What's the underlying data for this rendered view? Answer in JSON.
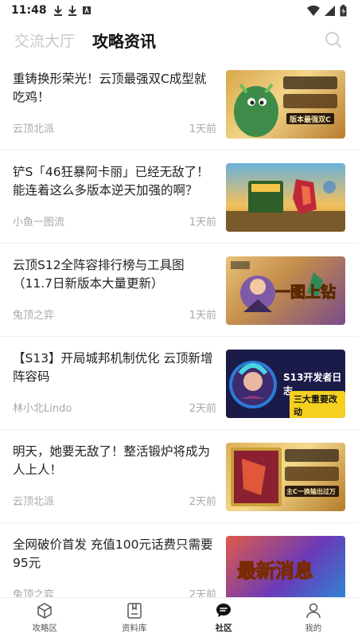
{
  "status": {
    "time": "11:48"
  },
  "header": {
    "tab_inactive": "交流大厅",
    "tab_active": "攻略资讯"
  },
  "articles": [
    {
      "title": "重铸换形荣光！云顶最强双C成型就吃鸡！",
      "author": "云顶北派",
      "time": "1天前",
      "thumb_text": "版本最强双C"
    },
    {
      "title": "铲S「46狂暴阿卡丽」已经无敌了！能连着这么多版本逆天加强的啊？",
      "author": "小鱼一图流",
      "time": "1天前",
      "thumb_text": ""
    },
    {
      "title": "云顶S12全阵容排行榜与工具图（11.7日新版本大量更新）",
      "author": "兔顶之弈",
      "time": "1天前",
      "thumb_text": "一图上钻"
    },
    {
      "title": "【S13】开局城邦机制优化 云顶新增阵容码",
      "author": "林小北Lindo",
      "time": "2天前",
      "thumb_text": "S13开发者日志",
      "thumb_sub": "三大重要改动"
    },
    {
      "title": "明天，她要无敌了！整活锻炉将成为人上人！",
      "author": "云顶北派",
      "time": "2天前",
      "thumb_text": "主C一换输出过万"
    },
    {
      "title": "全网破价首发 充值100元话费只需要95元",
      "author": "兔顶之弈",
      "time": "2天前",
      "thumb_text": "最新消息"
    }
  ],
  "tabbar": {
    "items": [
      {
        "label": "攻略区"
      },
      {
        "label": "资料库"
      },
      {
        "label": "社区"
      },
      {
        "label": "我的"
      }
    ]
  }
}
